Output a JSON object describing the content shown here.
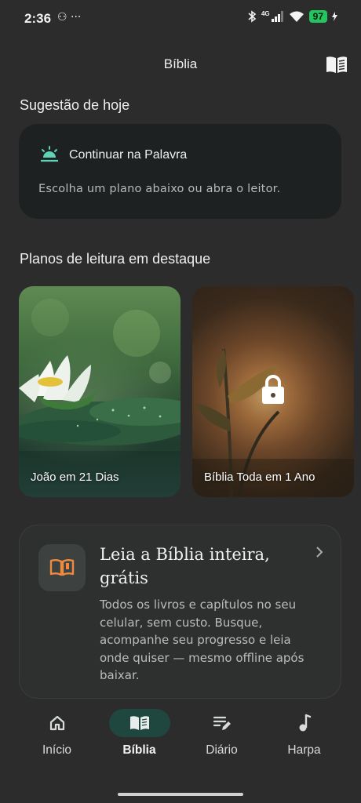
{
  "status_bar": {
    "time": "2:36",
    "left_icons": "⚇ ···",
    "network": "4G",
    "battery": "97"
  },
  "header": {
    "title": "Bíblia"
  },
  "today": {
    "section_title": "Sugestão de hoje",
    "card_title": "Continuar na Palavra",
    "card_subtitle": "Escolha um plano abaixo ou abra o leitor."
  },
  "plans": {
    "section_title": "Planos de leitura em destaque",
    "items": [
      {
        "label": "João em 21 Dias",
        "locked": false
      },
      {
        "label": "Bíblia Toda em 1 Ano",
        "locked": true
      }
    ]
  },
  "promo": {
    "title": "Leia a Bíblia inteira, grátis",
    "body": "Todos os livros e capítulos no seu celular, sem custo. Busque, acompanhe seu progresso e leia onde quiser — mesmo offline após baixar."
  },
  "nav": {
    "items": [
      {
        "label": "Início",
        "icon": "home-icon"
      },
      {
        "label": "Bíblia",
        "icon": "book-icon",
        "active": true
      },
      {
        "label": "Diário",
        "icon": "notes-icon"
      },
      {
        "label": "Harpa",
        "icon": "music-note-icon"
      }
    ]
  },
  "colors": {
    "background": "#2b2c2b",
    "card": "#1d2121",
    "accent": "#5fd3b8",
    "promo_icon": "#f08a3c",
    "active_nav": "#1f4740"
  }
}
